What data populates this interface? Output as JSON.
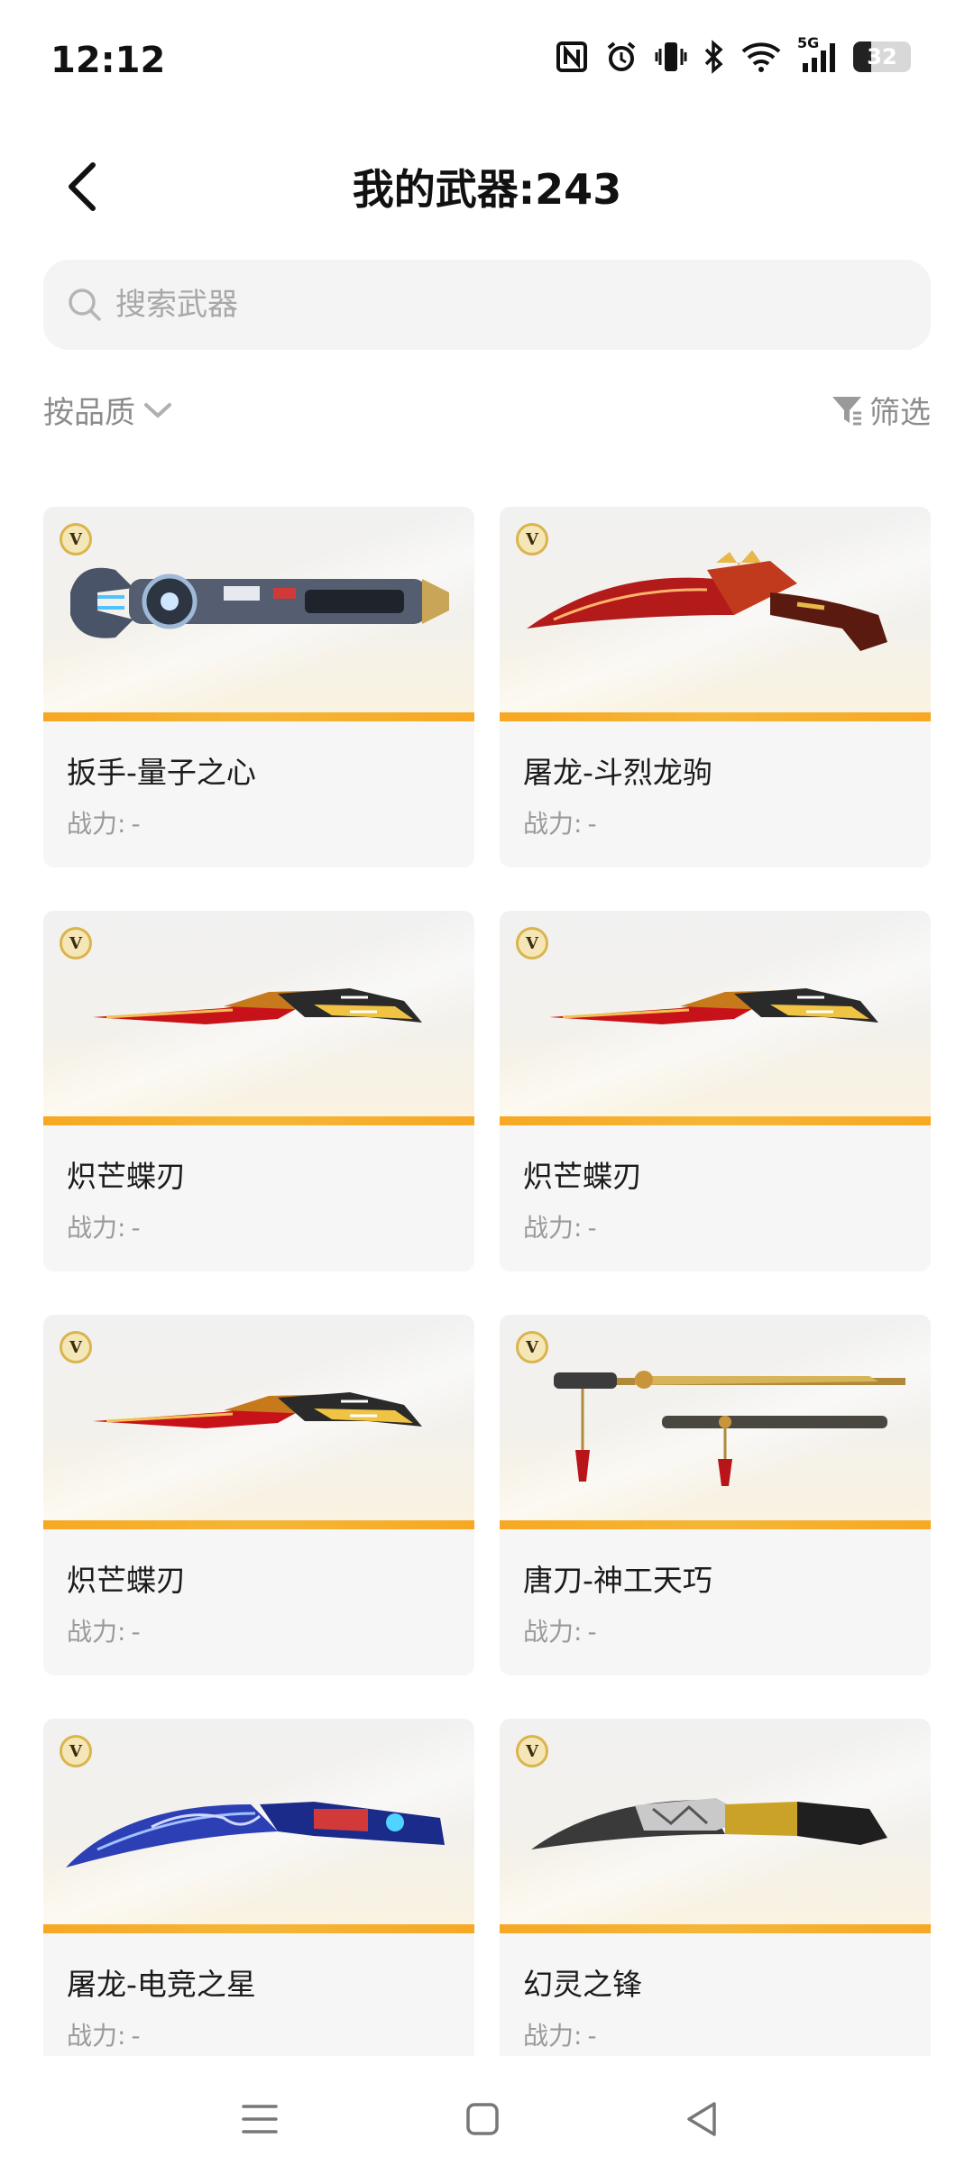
{
  "status_bar": {
    "time": "12:12",
    "battery_level": "32",
    "network_label": "5G",
    "icons": [
      "nfc-icon",
      "alarm-icon",
      "vibrate-icon",
      "bluetooth-icon",
      "wifi-icon",
      "signal-icon",
      "battery-icon"
    ]
  },
  "header": {
    "title": "我的武器:243",
    "back_icon": "chevron-left-icon"
  },
  "search": {
    "placeholder": "搜索武器",
    "value": ""
  },
  "toolbar": {
    "sort_label": "按品质",
    "filter_label": "筛选"
  },
  "weapons": [
    {
      "name": "扳手-量子之心",
      "power_label": "战力:",
      "power_value": "-",
      "badge": "V",
      "art": "wrench"
    },
    {
      "name": "屠龙-斗烈龙驹",
      "power_label": "战力:",
      "power_value": "-",
      "badge": "V",
      "art": "kukri-red"
    },
    {
      "name": "炽芒蝶刃",
      "power_label": "战力:",
      "power_value": "-",
      "badge": "V",
      "art": "butterfly"
    },
    {
      "name": "炽芒蝶刃",
      "power_label": "战力:",
      "power_value": "-",
      "badge": "V",
      "art": "butterfly"
    },
    {
      "name": "炽芒蝶刃",
      "power_label": "战力:",
      "power_value": "-",
      "badge": "V",
      "art": "butterfly"
    },
    {
      "name": "唐刀-神工天巧",
      "power_label": "战力:",
      "power_value": "-",
      "badge": "V",
      "art": "tang-sword"
    },
    {
      "name": "屠龙-电竞之星",
      "power_label": "战力:",
      "power_value": "-",
      "badge": "V",
      "art": "kukri-blue"
    },
    {
      "name": "幻灵之锋",
      "power_label": "战力:",
      "power_value": "-",
      "badge": "V",
      "art": "kukri-dark"
    }
  ],
  "nav": {
    "items": [
      "menu-icon",
      "home-icon",
      "back-triangle-icon"
    ]
  },
  "colors": {
    "accent_bar": "#f7a823",
    "card_bg": "#f6f6f6",
    "search_bg": "#f4f4f4",
    "muted_text": "#8c8c8c"
  }
}
